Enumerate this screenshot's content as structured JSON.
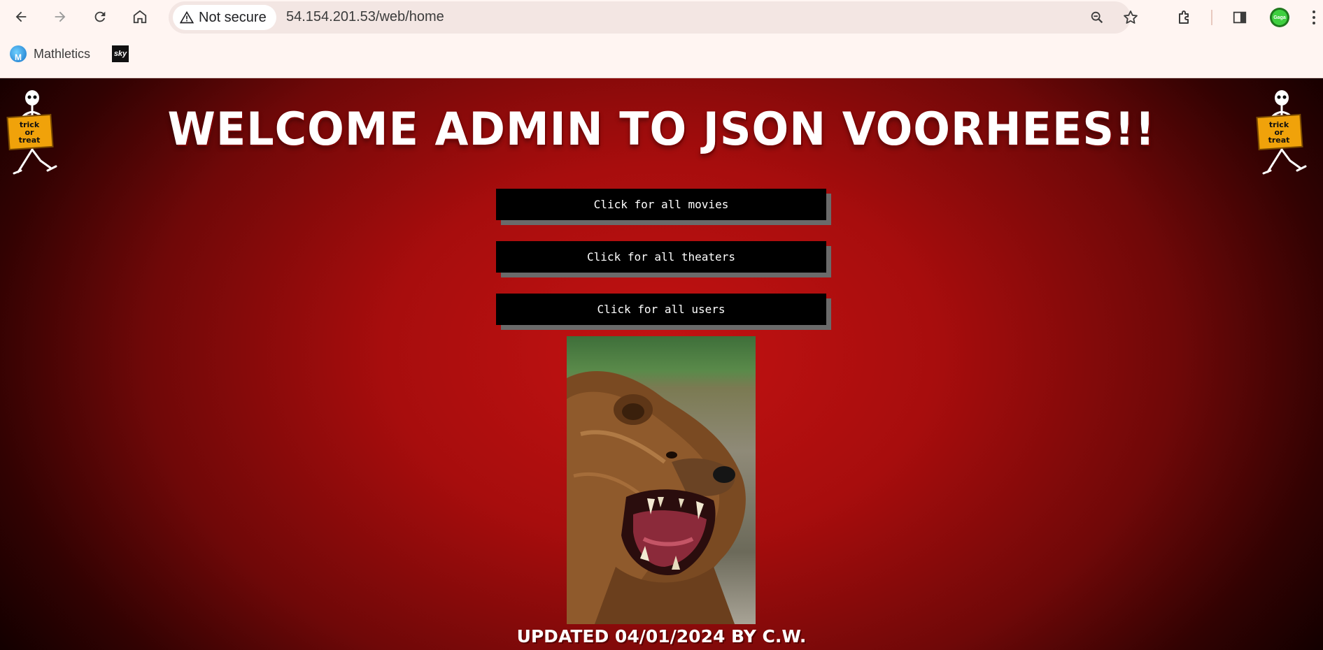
{
  "browser": {
    "security_label": "Not secure",
    "url": "54.154.201.53/web/home",
    "bookmarks": [
      {
        "label": "Mathletics",
        "icon": "mathletics-icon"
      },
      {
        "label": "",
        "icon": "sky-icon",
        "icon_text": "sky"
      }
    ],
    "profile_text": "Gaga"
  },
  "page": {
    "title": "WELCOME ADMIN TO JSON VOORHEES!!",
    "buttons": [
      {
        "label": "Click for all movies"
      },
      {
        "label": "Click for all theaters"
      },
      {
        "label": "Click for all users"
      }
    ],
    "skeleton_sign": {
      "line1": "trick",
      "line2": "or",
      "line3": "treat"
    },
    "footer": "UPDATED 04/01/2024 BY C.W.",
    "colors": {
      "background": "#b30f0f",
      "button_bg": "#000000",
      "button_shadow": "#6a6a6a"
    }
  }
}
